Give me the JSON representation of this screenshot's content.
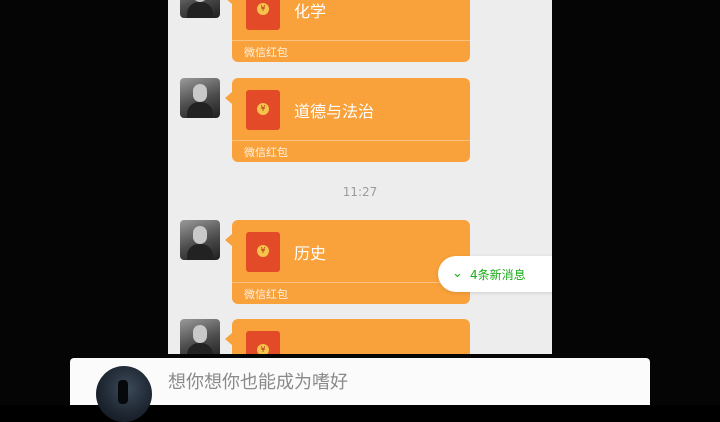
{
  "chat": {
    "messages": [
      {
        "title": "化学",
        "footer": "微信红包"
      },
      {
        "title": "道德与法治",
        "footer": "微信红包"
      },
      {
        "title": "历史",
        "footer": "微信红包"
      },
      {
        "title": "",
        "footer": ""
      }
    ],
    "timestamp": "11:27",
    "new_messages": {
      "icon": "double-chevron-down-icon",
      "label": "4条新消息"
    }
  },
  "comment": {
    "text": "想你想你也能成为嗜好"
  },
  "colors": {
    "red_packet": "#f9a23b",
    "envelope": "#e24a28",
    "accent_green": "#1aad19",
    "chat_bg": "#ededed"
  }
}
